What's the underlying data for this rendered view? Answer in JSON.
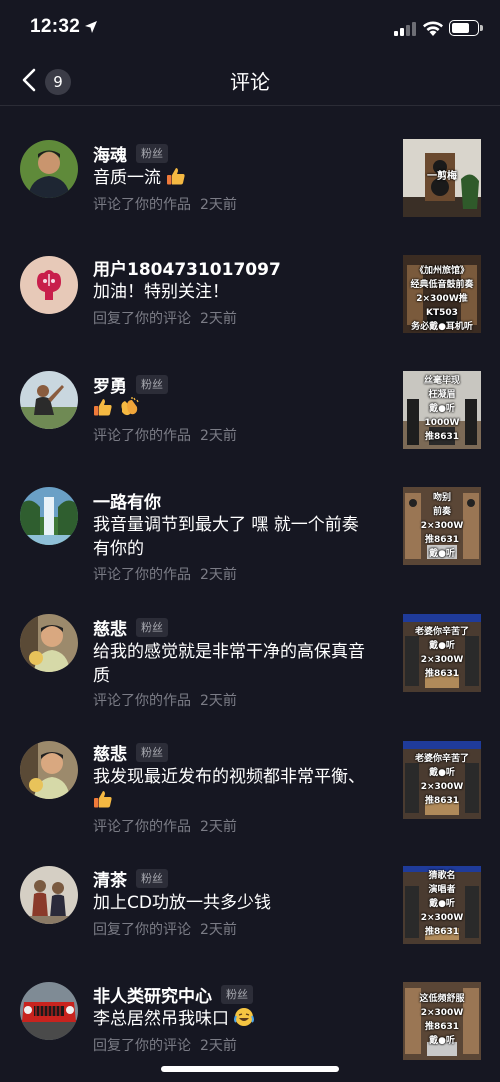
{
  "status_bar": {
    "time": "12:32",
    "icons": [
      "location-arrow-icon",
      "signal-icon",
      "wifi-icon",
      "battery-icon"
    ]
  },
  "nav": {
    "title": "评论",
    "badge_count": "9",
    "back_icon": "chevron-left-icon"
  },
  "comments": [
    {
      "name": "海魂",
      "tag": "粉丝",
      "text": "音质一流",
      "emojis": [
        "thumbs-up"
      ],
      "action": "评论了你的作品",
      "ago": "2天前",
      "thumb_lines": [
        "一剪梅"
      ]
    },
    {
      "name": "用户1804731017097",
      "tag": "",
      "text": "加油！特别关注！",
      "emojis": [],
      "action": "回复了你的评论",
      "ago": "2天前",
      "thumb_lines": [
        "《加州旅馆》",
        "经典低音鼓前奏",
        "2×300W推KT503",
        "务必戴●耳机听"
      ]
    },
    {
      "name": "罗勇",
      "tag": "粉丝",
      "text": "",
      "emojis": [
        "thumbs-up",
        "clapping-hands"
      ],
      "action": "评论了你的作品",
      "ago": "2天前",
      "thumb_lines": [
        "丝毫毕现",
        "枉凝眉",
        "戴●听",
        "1000W",
        "推8631"
      ]
    },
    {
      "name": "一路有你",
      "tag": "",
      "text": "我音量调节到最大了 嘿 就一个前奏 有你的",
      "emojis": [],
      "action": "评论了你的作品",
      "ago": "2天前",
      "thumb_lines": [
        "吻别",
        "前奏",
        "2×300W",
        "推8631",
        "戴●听"
      ]
    },
    {
      "name": "慈悲",
      "tag": "粉丝",
      "text": "给我的感觉就是非常干净的高保真音质",
      "emojis": [],
      "action": "评论了你的作品",
      "ago": "2天前",
      "thumb_lines": [
        "老婆你辛苦了",
        "戴●听",
        "2×300W",
        "推8631"
      ]
    },
    {
      "name": "慈悲",
      "tag": "粉丝",
      "text": "我发现最近发布的视频都非常平衡、",
      "emojis": [
        "thumbs-up"
      ],
      "action": "评论了你的作品",
      "ago": "2天前",
      "thumb_lines": [
        "老婆你辛苦了",
        "戴●听",
        "2×300W",
        "推8631"
      ]
    },
    {
      "name": "清茶",
      "tag": "粉丝",
      "text": "加上CD功放一共多少钱",
      "emojis": [],
      "action": "回复了你的评论",
      "ago": "2天前",
      "thumb_lines": [
        "猜歌名",
        "演唱者",
        "戴●听",
        "2×300W",
        "推8631"
      ]
    },
    {
      "name": "非人类研究中心",
      "tag": "粉丝",
      "text": "李总居然吊我味口",
      "emojis": [
        "laughing-tears"
      ],
      "action": "回复了你的评论",
      "ago": "2天前",
      "thumb_lines": [
        "这低频舒服",
        "2×300W",
        "推8631",
        "戴●听"
      ]
    }
  ]
}
